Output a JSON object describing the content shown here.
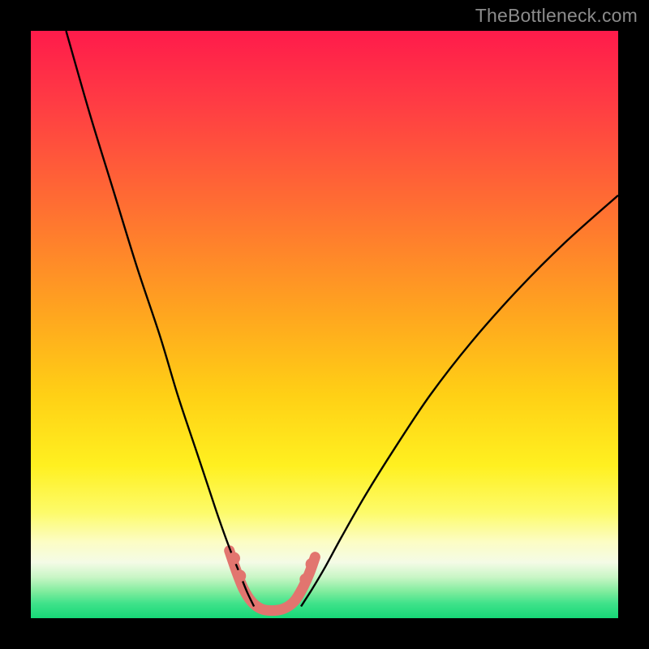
{
  "watermark": "TheBottleneck.com",
  "chart_data": {
    "type": "line",
    "title": "",
    "xlabel": "",
    "ylabel": "",
    "xlim": [
      0,
      100
    ],
    "ylim": [
      0,
      100
    ],
    "background_gradient_stops": [
      {
        "offset": 0.0,
        "color": "#ff1b4b"
      },
      {
        "offset": 0.12,
        "color": "#ff3b44"
      },
      {
        "offset": 0.3,
        "color": "#ff6f32"
      },
      {
        "offset": 0.48,
        "color": "#ffa51f"
      },
      {
        "offset": 0.62,
        "color": "#ffd015"
      },
      {
        "offset": 0.74,
        "color": "#fff020"
      },
      {
        "offset": 0.82,
        "color": "#fdfb6a"
      },
      {
        "offset": 0.87,
        "color": "#fcfdc4"
      },
      {
        "offset": 0.905,
        "color": "#f4fbe6"
      },
      {
        "offset": 0.93,
        "color": "#c9f6c6"
      },
      {
        "offset": 0.955,
        "color": "#7fec9d"
      },
      {
        "offset": 0.975,
        "color": "#3fe28a"
      },
      {
        "offset": 1.0,
        "color": "#17d877"
      }
    ],
    "series": [
      {
        "name": "left_curve",
        "stroke": "#000000",
        "stroke_width": 2.4,
        "x": [
          6,
          10,
          14,
          18,
          22,
          25,
          28,
          30,
          32,
          33.8,
          35.4,
          36.8,
          38
        ],
        "y": [
          100,
          86,
          73,
          60,
          48,
          38,
          29,
          23,
          17,
          12,
          8,
          4.5,
          2
        ]
      },
      {
        "name": "right_curve",
        "stroke": "#000000",
        "stroke_width": 2.4,
        "x": [
          46,
          47.8,
          50,
          53,
          57,
          62,
          68,
          75,
          83,
          91,
          100
        ],
        "y": [
          2,
          4.8,
          8.5,
          14,
          21,
          29,
          38,
          47,
          56,
          64,
          72
        ]
      },
      {
        "name": "trough_band",
        "stroke": "#e2756f",
        "stroke_width": 13,
        "linecap": "round",
        "x": [
          33.8,
          35.0,
          36.2,
          37.6,
          39.2,
          41.0,
          43.0,
          44.8,
          46.2,
          47.4,
          48.4
        ],
        "y": [
          11.5,
          8.0,
          5.0,
          2.8,
          1.6,
          1.3,
          1.6,
          2.8,
          5.0,
          7.6,
          10.4
        ]
      }
    ],
    "trough_dots": {
      "color": "#e2756f",
      "radius": 7.5,
      "points": [
        {
          "x": 34.6,
          "y": 10.2
        },
        {
          "x": 35.6,
          "y": 7.2
        },
        {
          "x": 46.8,
          "y": 6.6
        },
        {
          "x": 47.8,
          "y": 9.2
        }
      ]
    }
  }
}
